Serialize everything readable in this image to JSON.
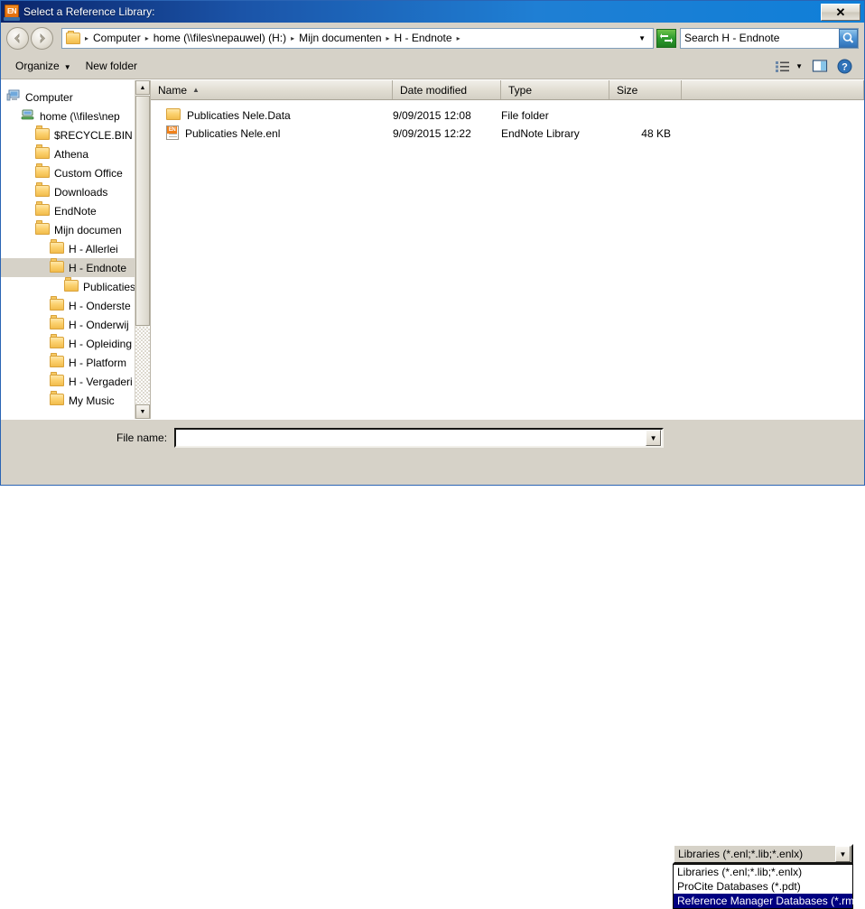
{
  "window": {
    "title": "Select a Reference Library:",
    "app_icon": "endnote-icon",
    "close_label": "✕"
  },
  "navigation": {
    "back_icon": "back-arrow-icon",
    "forward_icon": "forward-arrow-icon",
    "breadcrumbs": [
      {
        "label": "Computer"
      },
      {
        "label": "home (\\\\files\\nepauwel) (H:)"
      },
      {
        "label": "Mijn documenten"
      },
      {
        "label": "H - Endnote"
      }
    ],
    "separator": "▸",
    "history_caret": "▼",
    "refresh_icon": "refresh-icon"
  },
  "search": {
    "value": "Search H - Endnote",
    "placeholder": "Search H - Endnote",
    "button_icon": "search-icon"
  },
  "toolbar": {
    "organize_label": "Organize",
    "organize_caret": "▼",
    "new_folder_label": "New folder",
    "view_icon": "view-list-icon",
    "view_caret": "▼",
    "preview_pane_icon": "preview-pane-icon",
    "help_icon": "help-icon"
  },
  "sidebar": {
    "items": [
      {
        "label": "Computer",
        "icon": "computer-icon",
        "indent": 0,
        "selected": false
      },
      {
        "label": "home (\\\\files\\nep",
        "icon": "network-drive-icon",
        "indent": 1,
        "selected": false
      },
      {
        "label": "$RECYCLE.BIN",
        "icon": "folder-icon",
        "indent": 2,
        "selected": false
      },
      {
        "label": "Athena",
        "icon": "folder-icon",
        "indent": 2,
        "selected": false
      },
      {
        "label": "Custom Office",
        "icon": "folder-icon",
        "indent": 2,
        "selected": false
      },
      {
        "label": "Downloads",
        "icon": "folder-icon",
        "indent": 2,
        "selected": false
      },
      {
        "label": "EndNote",
        "icon": "folder-icon",
        "indent": 2,
        "selected": false
      },
      {
        "label": "Mijn documen",
        "icon": "folder-icon",
        "indent": 2,
        "selected": false
      },
      {
        "label": "H - Allerlei",
        "icon": "folder-icon",
        "indent": 3,
        "selected": false
      },
      {
        "label": "H - Endnote",
        "icon": "folder-icon",
        "indent": 3,
        "selected": true
      },
      {
        "label": "Publicaties",
        "icon": "folder-icon",
        "indent": 4,
        "selected": false
      },
      {
        "label": "H - Onderste",
        "icon": "folder-icon",
        "indent": 3,
        "selected": false
      },
      {
        "label": "H - Onderwij",
        "icon": "folder-icon",
        "indent": 3,
        "selected": false
      },
      {
        "label": "H - Opleiding",
        "icon": "folder-icon",
        "indent": 3,
        "selected": false
      },
      {
        "label": "H - Platform",
        "icon": "folder-icon",
        "indent": 3,
        "selected": false
      },
      {
        "label": "H - Vergaderi",
        "icon": "folder-icon",
        "indent": 3,
        "selected": false
      },
      {
        "label": "My Music",
        "icon": "folder-icon",
        "indent": 3,
        "selected": false
      }
    ],
    "scroll_up_icon": "▲",
    "scroll_down_icon": "▼"
  },
  "filelist": {
    "columns": [
      {
        "label": "Name",
        "sort": "▲"
      },
      {
        "label": "Date modified",
        "sort": ""
      },
      {
        "label": "Type",
        "sort": ""
      },
      {
        "label": "Size",
        "sort": ""
      }
    ],
    "rows": [
      {
        "name": "Publicaties Nele.Data",
        "icon": "folder-icon",
        "date_modified": "9/09/2015 12:08",
        "type": "File folder",
        "size": ""
      },
      {
        "name": "Publicaties Nele.enl",
        "icon": "endnote-library-icon",
        "date_modified": "9/09/2015 12:22",
        "type": "EndNote Library",
        "size": "48 KB"
      }
    ]
  },
  "footer": {
    "filename_label": "File name:",
    "filename_value": "",
    "filename_placeholder": "",
    "combo_caret": "▼",
    "filter": {
      "selected": "Libraries (*.enl;*.lib;*.enlx)",
      "caret": "▼",
      "expanded": true,
      "options": [
        {
          "label": "Libraries (*.enl;*.lib;*.enlx)",
          "highlighted": false
        },
        {
          "label": "ProCite Databases (*.pdt)",
          "highlighted": false
        },
        {
          "label": "Reference Manager Databases (*.rmd)",
          "highlighted": true
        }
      ]
    }
  },
  "colors": {
    "title_gradient_start": "#0a246a",
    "title_gradient_end": "#0f7fd8",
    "dialog_face": "#d6d2c8",
    "selection_blue": "#000080",
    "selection_gray": "#d6d2c8",
    "endnote_orange": "#f0811a",
    "folder_yellow": "#fcd270"
  }
}
